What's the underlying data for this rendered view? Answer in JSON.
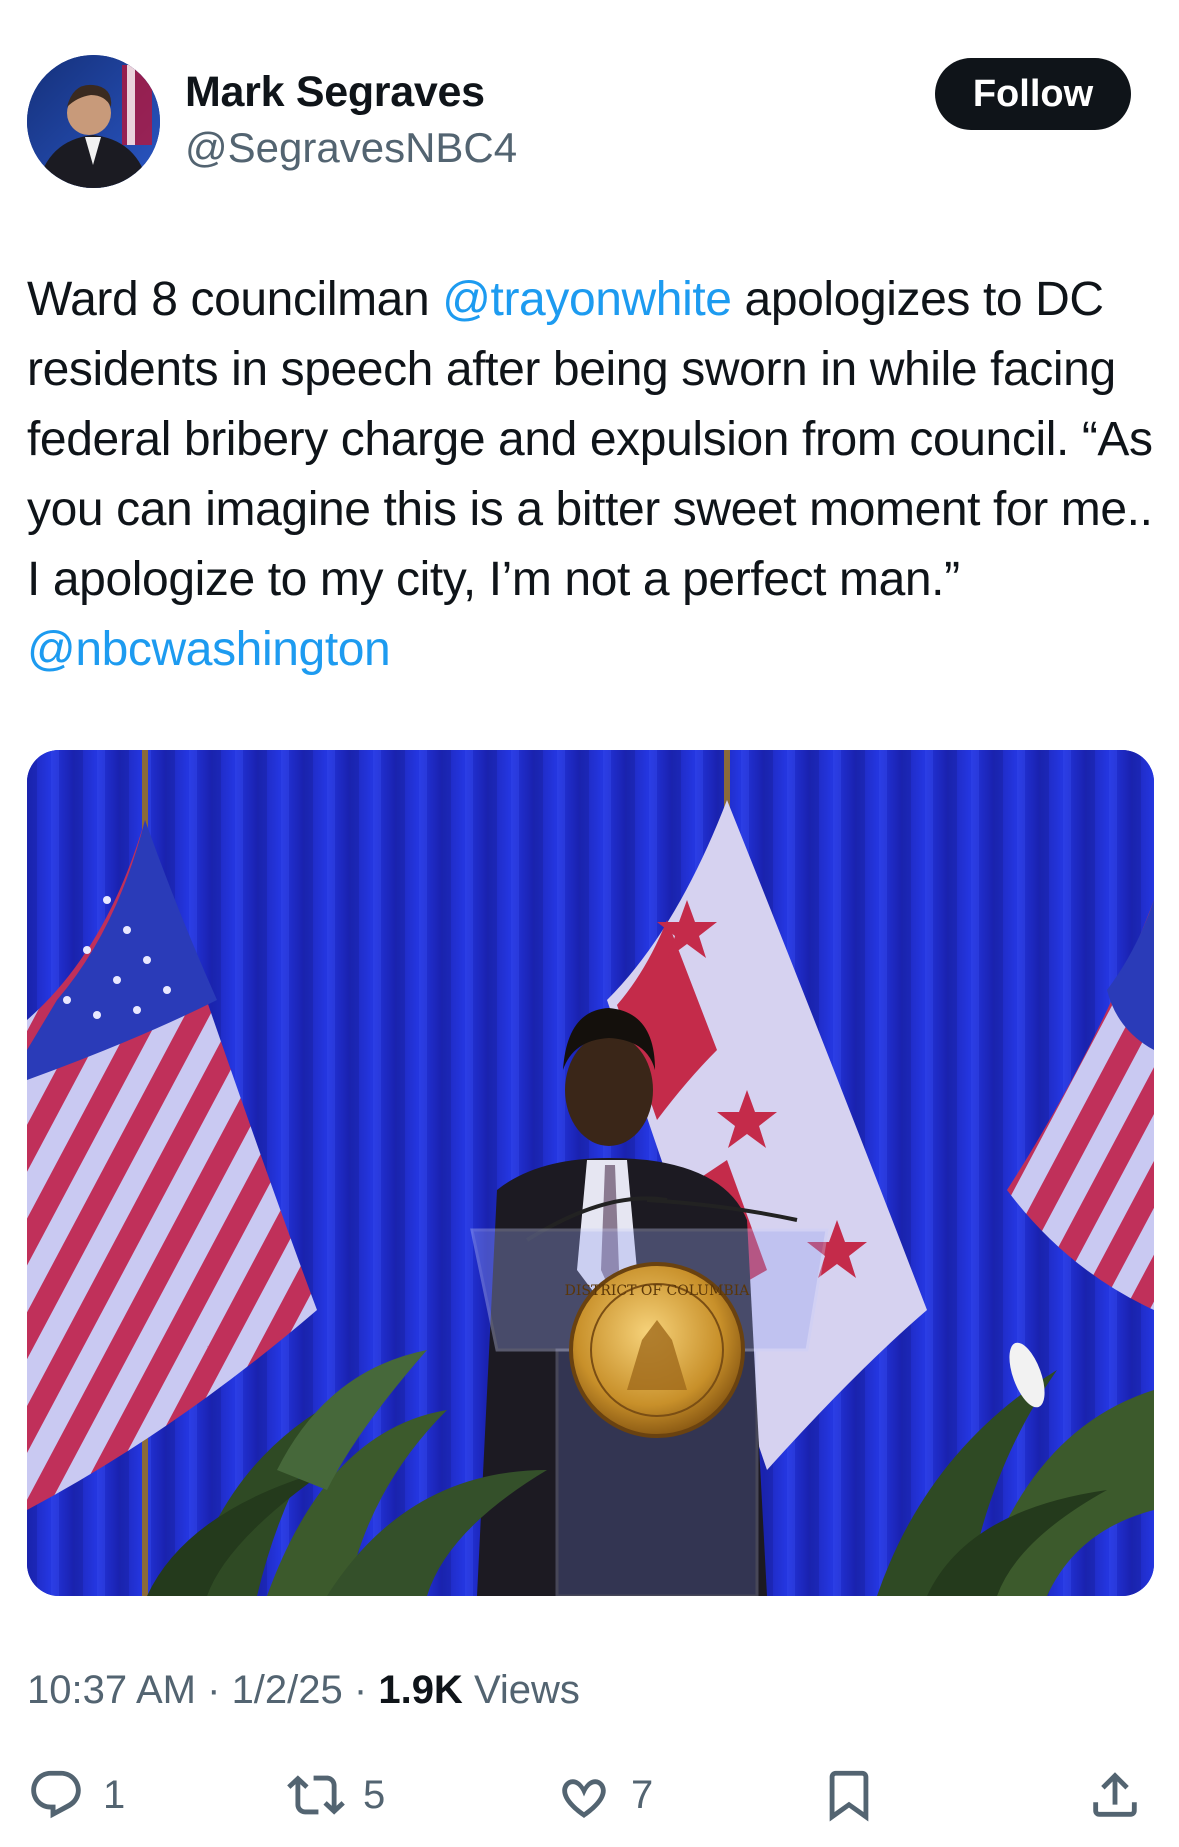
{
  "author": {
    "display_name": "Mark Segraves",
    "handle": "@SegravesNBC4"
  },
  "follow_button": {
    "label": "Follow"
  },
  "tweet": {
    "text_1": "Ward 8 councilman ",
    "mention_1": "@trayonwhite",
    "text_2": " apologizes to DC residents in speech after being sworn in while facing federal bribery charge and expulsion from council. “As you can imagine this is a bitter sweet moment for me.. I apologize to my city, I’m not a perfect man.” ",
    "mention_2": "@nbcwashington"
  },
  "media": {
    "seal_text": "DISTRICT OF COLUMBIA"
  },
  "meta": {
    "time": "10:37 AM",
    "separator": " · ",
    "date": "1/2/25",
    "views_count": "1.9K",
    "views_label": " Views"
  },
  "actions": {
    "reply_count": "1",
    "repost_count": "5",
    "like_count": "7"
  },
  "colors": {
    "accent": "#1d9bf0",
    "text": "#0f1419",
    "secondary": "#536471"
  },
  "icons": [
    "reply-icon",
    "repost-icon",
    "like-icon",
    "bookmark-icon",
    "share-icon"
  ]
}
